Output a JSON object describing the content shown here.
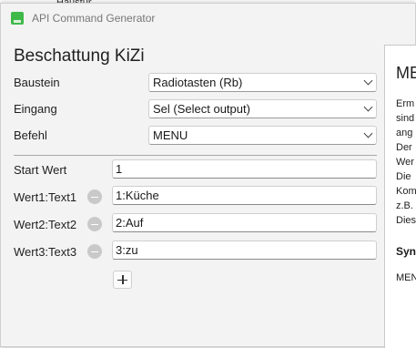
{
  "background": {
    "tab_text": "Haustür"
  },
  "window": {
    "title": "API Command Generator"
  },
  "form": {
    "heading": "Beschattung KiZi",
    "baustein": {
      "label": "Baustein",
      "value": "Radiotasten (Rb)"
    },
    "eingang": {
      "label": "Eingang",
      "value": "Sel (Select output)"
    },
    "befehl": {
      "label": "Befehl",
      "value": "MENU"
    },
    "start_wert": {
      "label": "Start Wert",
      "value": "1"
    },
    "rows": [
      {
        "label": "Wert1:Text1",
        "value": "1:Küche"
      },
      {
        "label": "Wert2:Text2",
        "value": "2:Auf"
      },
      {
        "label": "Wert3:Text3",
        "value": "3:zu"
      }
    ]
  },
  "side_panel": {
    "title": "ME",
    "lines": [
      "Erm",
      "sind",
      "ang",
      "Der",
      "Wer",
      "Die",
      "Kom",
      "z.B.",
      "Dies"
    ],
    "syntax_heading": "Syn",
    "code": "MEN"
  },
  "colors": {
    "icon_green": "#3fb94a",
    "remove_grey": "#c9c9c9"
  }
}
